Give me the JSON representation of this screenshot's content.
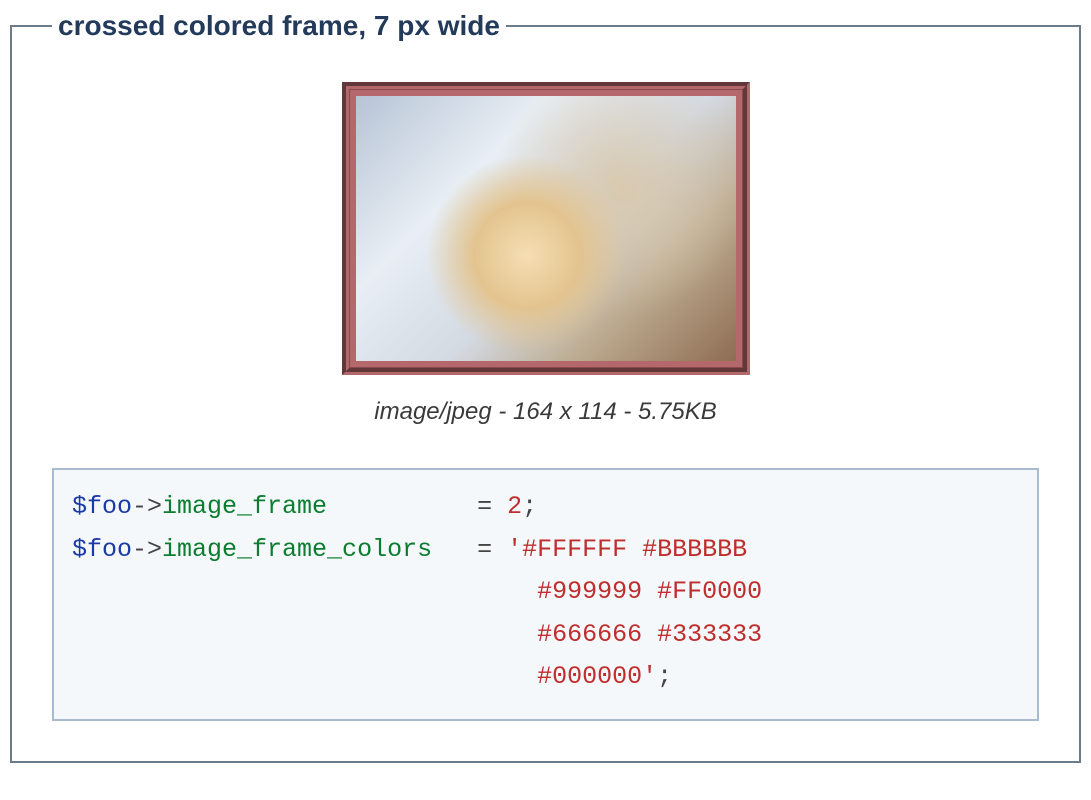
{
  "legend": "crossed colored frame, 7 px wide",
  "caption": "image/jpeg - 164 x 114 - 5.75KB",
  "code": {
    "var": "$foo",
    "arrow": "->",
    "lines": [
      {
        "prop": "image_frame",
        "pad": "          ",
        "eq": "= ",
        "rhs_type": "num",
        "rhs": "2",
        "semi": ";"
      },
      {
        "prop": "image_frame_colors",
        "pad": "   ",
        "eq": "= ",
        "rhs_type": "str_open",
        "rhs": "'#FFFFFF #BBBBBB"
      }
    ],
    "cont_indent": "                               ",
    "cont": [
      "#999999 #FF0000",
      "#666666 #333333"
    ],
    "tail": "#000000'",
    "tail_semi": ";"
  }
}
